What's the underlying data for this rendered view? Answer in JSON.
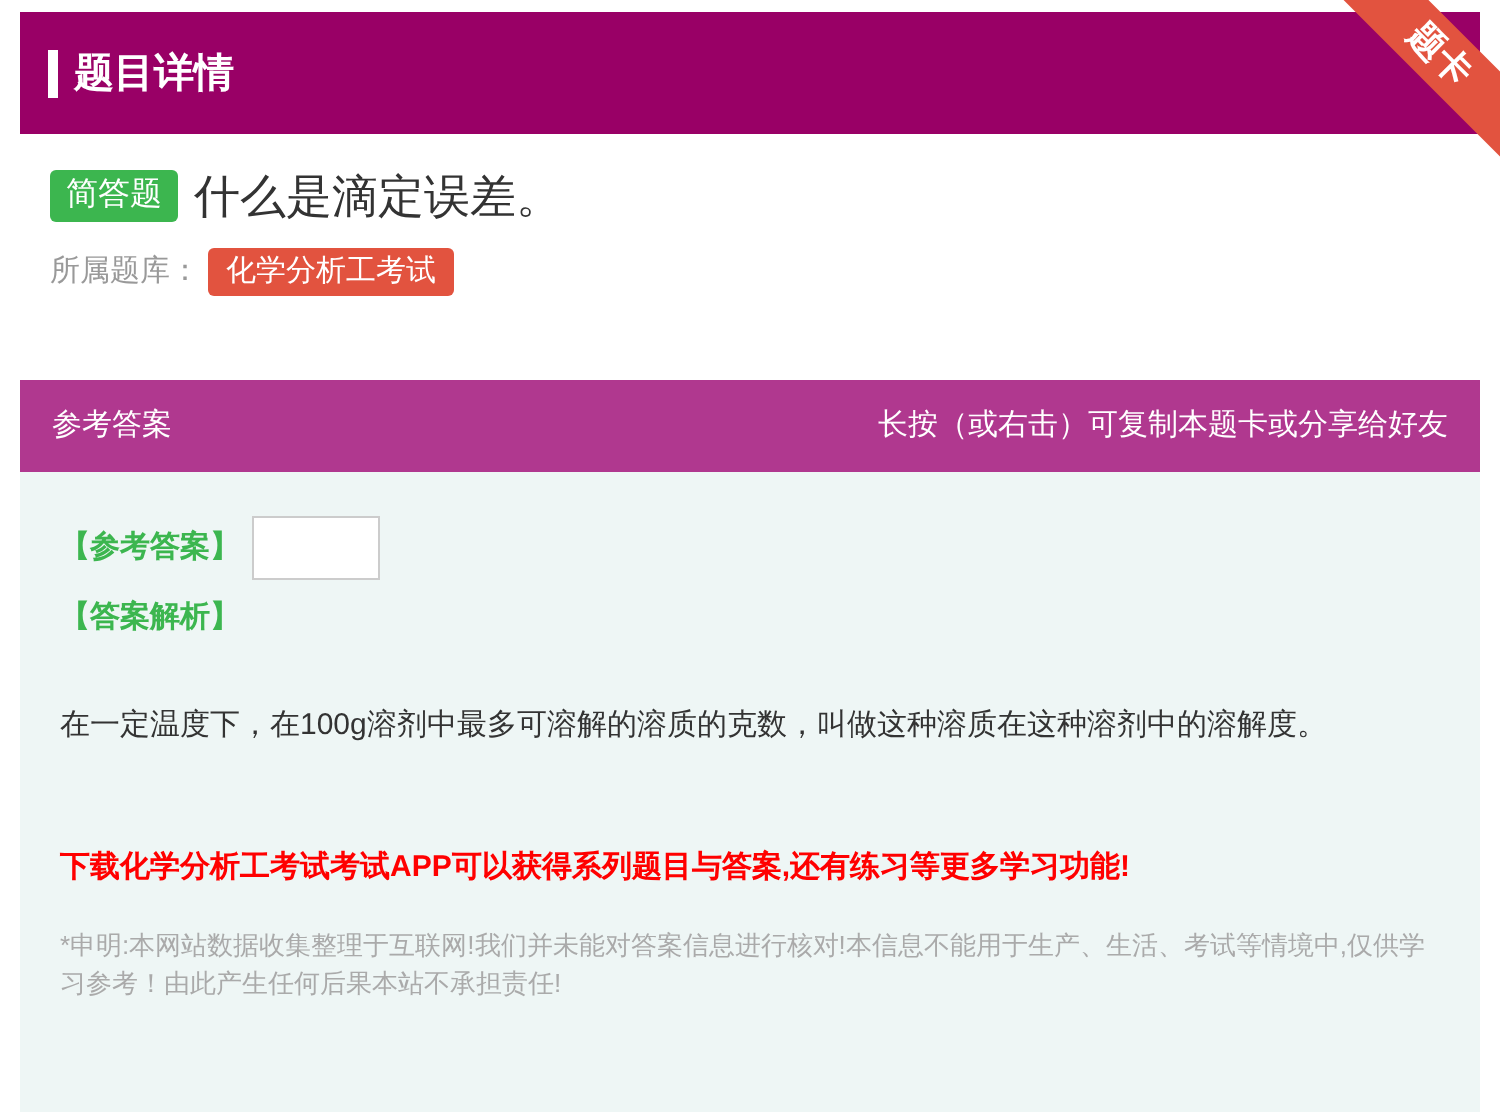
{
  "header": {
    "title": "题目详情",
    "ribbon": "题卡"
  },
  "question": {
    "type_tag": "简答题",
    "text": "什么是滴定误差。",
    "bank_label": "所属题库：",
    "bank": "化学分析工考试"
  },
  "answer_panel": {
    "title": "参考答案",
    "hint": "长按（或右击）可复制本题卡或分享给好友",
    "answer_label": "【参考答案】",
    "analysis_label": "【答案解析】",
    "analysis": "在一定温度下，在100g溶剂中最多可溶解的溶质的克数，叫做这种溶质在这种溶剂中的溶解度。",
    "promo": "下载化学分析工考试考试APP可以获得系列题目与答案,还有练习等更多学习功能!",
    "disclaimer": "*申明:本网站数据收集整理于互联网!我们并未能对答案信息进行核对!本信息不能用于生产、生活、考试等情境中,仅供学习参考！由此产生任何后果本站不承担责任!"
  }
}
